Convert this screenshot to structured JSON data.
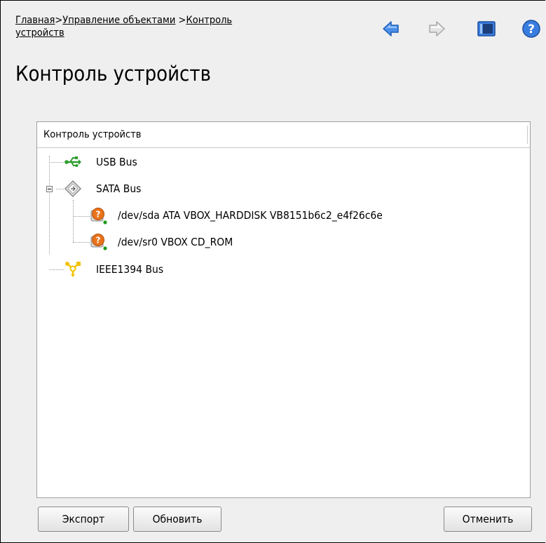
{
  "breadcrumb": {
    "home": "Главная",
    "sep1": ">",
    "objects": "Управление объектами",
    "sep2": ">",
    "current_line1": "Контроль ",
    "current_line2": "устройств"
  },
  "page_title": "Контроль устройств",
  "toolbar": {
    "back_icon": "arrow-left-icon",
    "forward_icon": "arrow-right-icon",
    "panel_icon": "window-icon",
    "help_icon": "help-icon"
  },
  "tree": {
    "header": "Контроль устройств",
    "nodes": [
      {
        "label": "USB Bus",
        "icon": "usb-icon"
      },
      {
        "label": "SATA Bus",
        "icon": "sata-bus-icon"
      },
      {
        "label": "/dev/sda ATA VBOX_HARDDISK VB8151b6c2_e4f26c6e",
        "icon": "unknown-device-icon"
      },
      {
        "label": "/dev/sr0 VBOX CD_ROM",
        "icon": "unknown-device-icon"
      },
      {
        "label": "IEEE1394 Bus",
        "icon": "firewire-icon"
      }
    ]
  },
  "buttons": {
    "export": "Экспорт",
    "refresh": "Обновить",
    "cancel": "Отменить"
  },
  "colors": {
    "background": "#efefef",
    "toolbar_blue": "#3a7de0",
    "usb_green": "#2e9e2e",
    "firewire_yellow": "#f2c200",
    "warning_orange": "#e8731a"
  }
}
